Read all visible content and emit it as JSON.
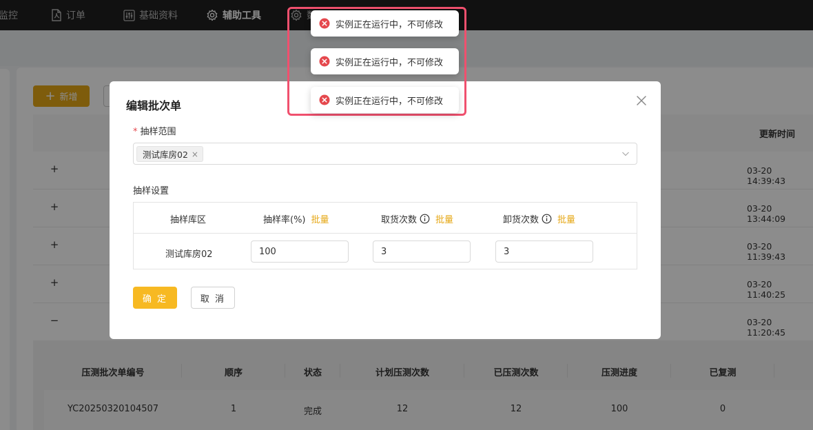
{
  "nav": {
    "items": [
      {
        "label": "监控"
      },
      {
        "label": "订单"
      },
      {
        "label": "基础资料"
      },
      {
        "label": "辅助工具"
      },
      {
        "label": "数"
      }
    ]
  },
  "toolbar": {
    "add_label": "新增"
  },
  "table": {
    "update_time_header": "更新时间",
    "rows": [
      {
        "expander": "+",
        "time": "03-20 14:39:43"
      },
      {
        "expander": "+",
        "time": "03-20 13:44:09"
      },
      {
        "expander": "+",
        "time": "03-20 11:39:43"
      },
      {
        "expander": "+",
        "time": "03-20 11:40:25"
      },
      {
        "expander": "−",
        "time": "03-20 11:20:45"
      }
    ]
  },
  "subtable": {
    "headers": [
      "压测批次单编号",
      "顺序",
      "状态",
      "计划压测次数",
      "已压测次数",
      "压测进度",
      "已复测"
    ],
    "row": [
      "YC20250320104507",
      "1",
      "完成",
      "12",
      "12",
      "100",
      "0"
    ]
  },
  "modal": {
    "title": "编辑批次单",
    "required_mark": "*",
    "range_label": "抽样范围",
    "selected_tag": "测试库房02",
    "tag_remove": "×",
    "settings_label": "抽样设置",
    "grid": {
      "col_area": "抽样库区",
      "col_rate": "抽样率(%)",
      "col_pick": "取货次数",
      "col_unload": "卸货次数",
      "batch_label": "批量",
      "area_value": "测试库房02",
      "rate_value": "100",
      "pick_value": "3",
      "unload_value": "3"
    },
    "ok_label": "确 定",
    "cancel_label": "取 消"
  },
  "toasts": [
    {
      "message": "实例正在运行中，不可修改"
    },
    {
      "message": "实例正在运行中，不可修改"
    },
    {
      "message": "实例正在运行中，不可修改"
    }
  ],
  "colors": {
    "accent": "#f7b922",
    "error": "#e5484d",
    "highlight": "#f0506e"
  }
}
